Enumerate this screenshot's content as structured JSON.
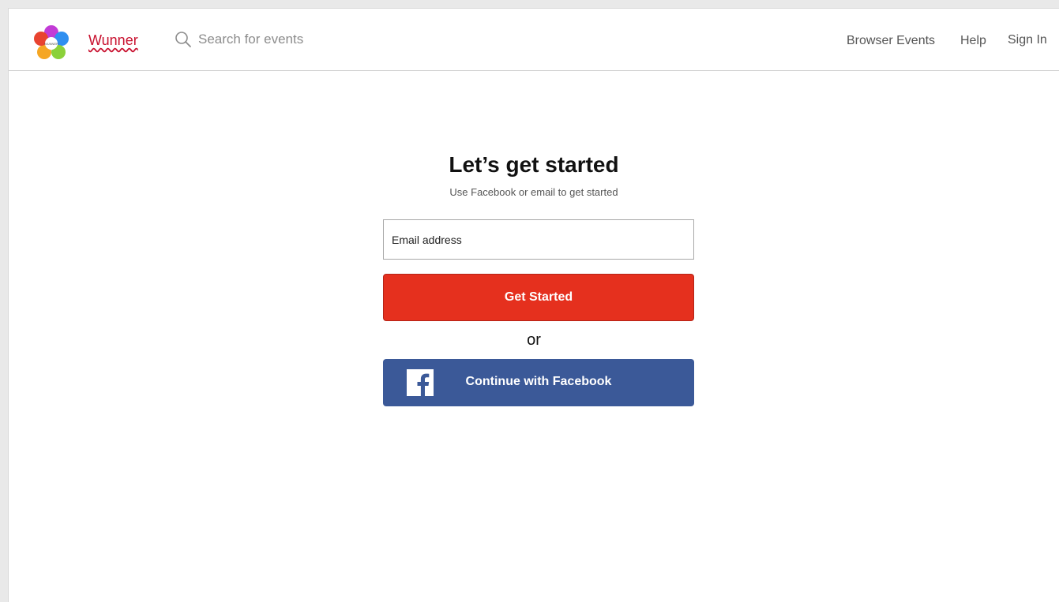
{
  "header": {
    "brand": "Wunner",
    "search_placeholder": "Search for events",
    "nav": {
      "browse_events": "Browser Events",
      "help": "Help",
      "sign_in": "Sign In"
    }
  },
  "main": {
    "title": "Let’s get started",
    "subtitle": "Use Facebook or email to get started",
    "email_placeholder": "Email address",
    "get_started_label": "Get Started",
    "or_label": "or",
    "facebook_label": "Continue with Facebook"
  },
  "icons": {
    "logo": "flower-logo-icon",
    "search": "search-icon",
    "facebook": "facebook-icon"
  },
  "colors": {
    "brand": "#c8102e",
    "primary_button": "#e5301e",
    "facebook_button": "#3b5998"
  }
}
